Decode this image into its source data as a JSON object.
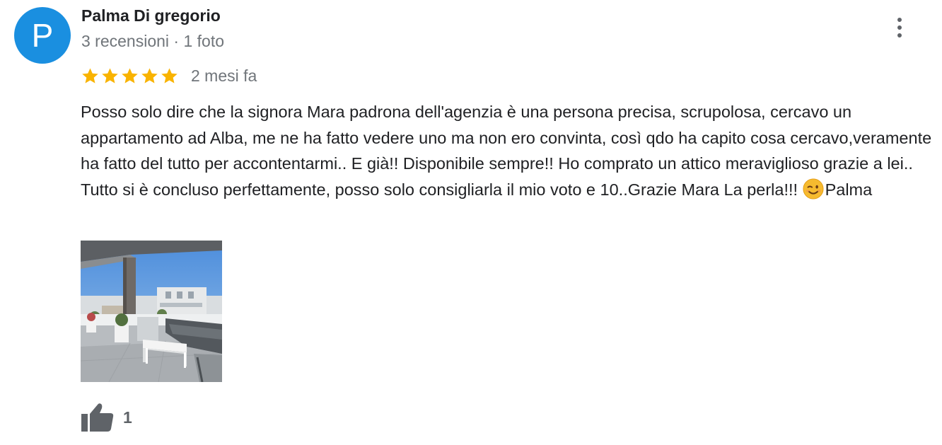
{
  "review": {
    "avatar_letter": "P",
    "author_name": "Palma Di gregorio",
    "author_meta": "3 recensioni · 1 foto",
    "rating": 5,
    "rating_max": 5,
    "date": "2 mesi fa",
    "text_main": "Posso solo dire che la signora Mara padrona dell'agenzia è una persona precisa, scrupolosa, cercavo un appartamento ad Alba, me ne ha fatto vedere uno ma non ero convinta, così qdo ha capito cosa cercavo,veramente ha fatto del tutto per accontentarmi.. E già!! Disponibile sempre!! Ho comprato un attico meraviglioso grazie a lei.. Tutto si è concluso perfettamente, posso solo consigliarla il mio voto e 10..Grazie Mara La perla!!! ",
    "text_emoji": "winking-face-emoji",
    "text_end": "Palma",
    "photo_icon": "rooftop-terrace-photo",
    "like_count": "1"
  },
  "colors": {
    "avatar_bg": "#1a8fe0",
    "star": "#f9b300",
    "secondary_text": "#70757a",
    "icon": "#5f6368"
  },
  "icons": {
    "more": "more-vert-icon",
    "star": "star-icon",
    "like": "thumb-up-icon"
  }
}
